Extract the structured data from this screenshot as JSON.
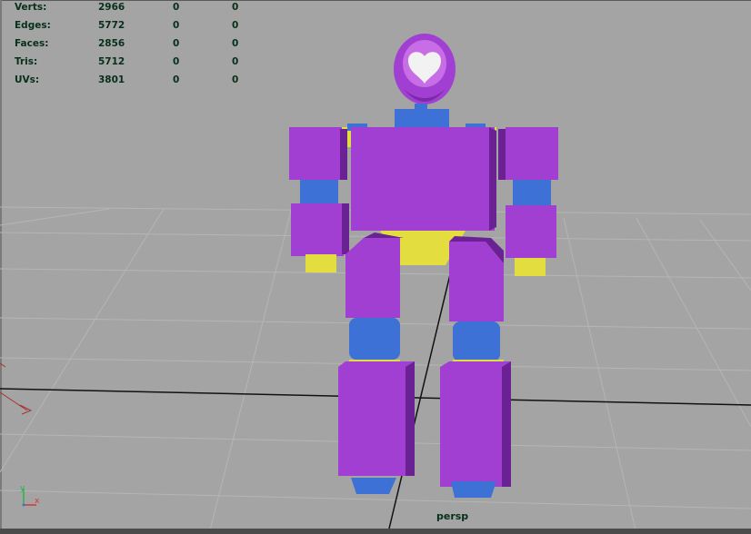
{
  "heads_up_display": {
    "rows": [
      {
        "label": "Verts:",
        "v1": "2966",
        "v2": "0",
        "v3": "0"
      },
      {
        "label": "Edges:",
        "v1": "5772",
        "v2": "0",
        "v3": "0"
      },
      {
        "label": "Faces:",
        "v1": "2856",
        "v2": "0",
        "v3": "0"
      },
      {
        "label": "Tris:",
        "v1": "5712",
        "v2": "0",
        "v3": "0"
      },
      {
        "label": "UVs:",
        "v1": "3801",
        "v2": "0",
        "v3": "0"
      }
    ]
  },
  "camera": {
    "name": "persp"
  },
  "axis_gizmo": {
    "y_label": "y",
    "x_label": "x"
  },
  "colors": {
    "viewport_bg": "#a4a4a4",
    "grid_line": "#b4b4b4",
    "grid_axis": "#111111",
    "hud_text": "#06301a",
    "robot_purple": "#a23fd3",
    "robot_blue": "#3d71d6",
    "robot_yellow": "#e4dd3f"
  }
}
